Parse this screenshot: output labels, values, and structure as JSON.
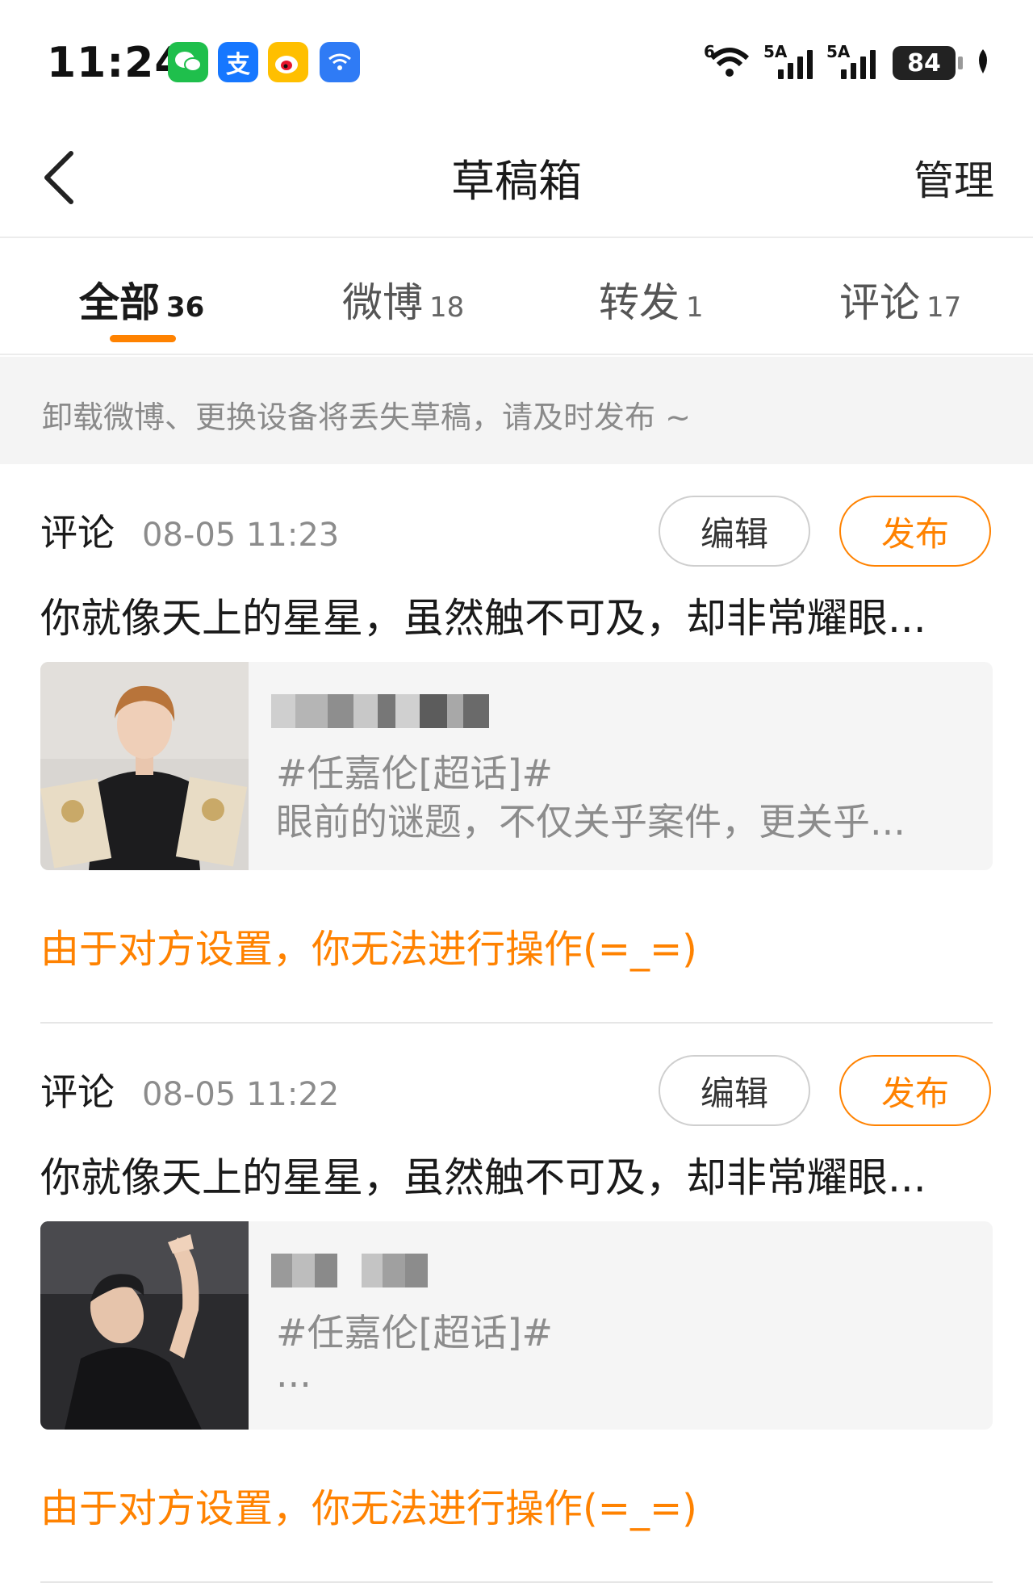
{
  "status_bar": {
    "time": "11:24",
    "app_icons": [
      "wechat-icon",
      "alipay-icon",
      "weibo-icon",
      "wifi-app-icon"
    ],
    "alipay_glyph": "支",
    "wifi_label": "6",
    "sim1_label": "5A",
    "sim2_label": "5A",
    "battery": "84"
  },
  "nav": {
    "title": "草稿箱",
    "manage_label": "管理"
  },
  "tabs": [
    {
      "label": "全部",
      "count": "36",
      "active": true
    },
    {
      "label": "微博",
      "count": "18",
      "active": false
    },
    {
      "label": "转发",
      "count": "1",
      "active": false
    },
    {
      "label": "评论",
      "count": "17",
      "active": false
    }
  ],
  "notice": "卸载微博、更换设备将丢失草稿，请及时发布 ~",
  "drafts": [
    {
      "type": "评论",
      "time": "08-05 11:23",
      "edit_label": "编辑",
      "publish_label": "发布",
      "text": "你就像天上的星星，虽然触不可及，却非常耀眼...",
      "quote_tag": "#任嘉伦[超话]#",
      "quote_body": "眼前的谜题，不仅关乎案件，更关乎...",
      "warning": "由于对方设置，你无法进行操作(=_=)"
    },
    {
      "type": "评论",
      "time": "08-05 11:22",
      "edit_label": "编辑",
      "publish_label": "发布",
      "text": "你就像天上的星星，虽然触不可及，却非常耀眼...",
      "quote_tag": "#任嘉伦[超话]#",
      "quote_body": "...",
      "warning": "由于对方设置，你无法进行操作(=_=)"
    }
  ],
  "colors": {
    "accent": "#ff8200",
    "muted_text": "#8c8c8c",
    "notice_bg": "#f4f4f4"
  }
}
